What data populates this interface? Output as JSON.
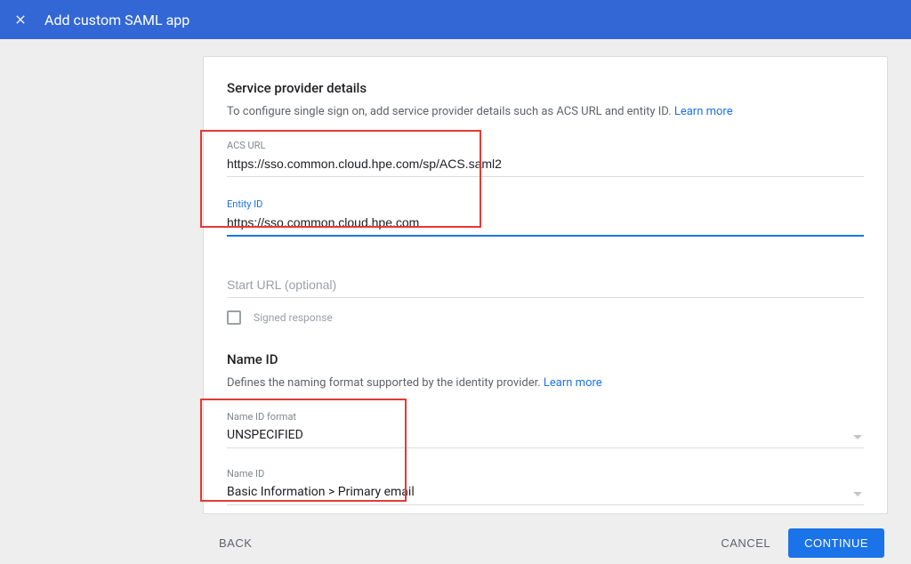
{
  "topbar": {
    "title": "Add custom SAML app"
  },
  "section1": {
    "title": "Service provider details",
    "desc": "To configure single sign on, add service provider details such as ACS URL and entity ID. ",
    "learn": "Learn more"
  },
  "fields": {
    "acs": {
      "label": "ACS URL",
      "value": "https://sso.common.cloud.hpe.com/sp/ACS.saml2"
    },
    "entity": {
      "label": "Entity ID",
      "value": "https://sso.common.cloud.hpe.com"
    },
    "start": {
      "placeholder": "Start URL (optional)"
    },
    "signed": {
      "label": "Signed response"
    }
  },
  "section2": {
    "title": "Name ID",
    "desc": "Defines the naming format supported by the identity provider. ",
    "learn": "Learn more"
  },
  "selects": {
    "format": {
      "label": "Name ID format",
      "value": "UNSPECIFIED"
    },
    "nameid": {
      "label": "Name ID",
      "value": "Basic Information > Primary email"
    }
  },
  "footer": {
    "back": "Back",
    "cancel": "Cancel",
    "continue": "Continue"
  }
}
